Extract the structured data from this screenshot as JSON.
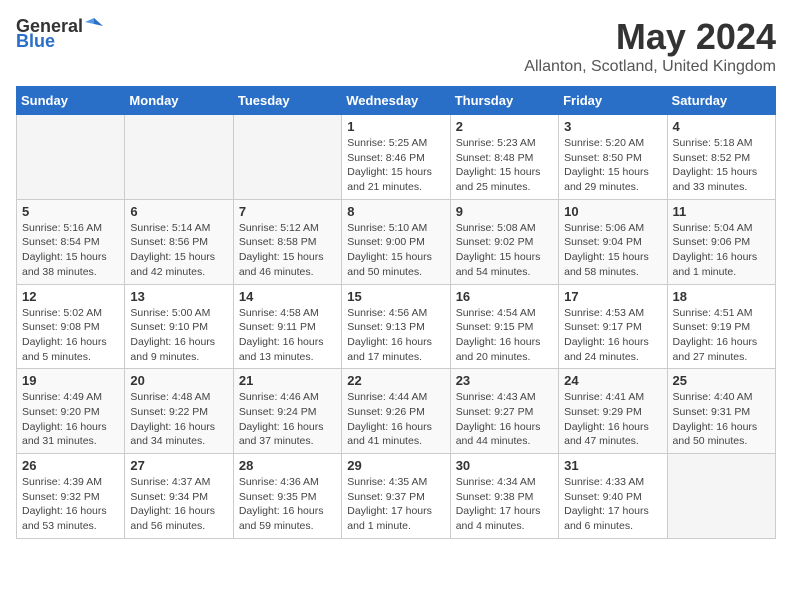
{
  "logo": {
    "general": "General",
    "blue": "Blue"
  },
  "title": "May 2024",
  "subtitle": "Allanton, Scotland, United Kingdom",
  "weekdays": [
    "Sunday",
    "Monday",
    "Tuesday",
    "Wednesday",
    "Thursday",
    "Friday",
    "Saturday"
  ],
  "weeks": [
    [
      {
        "day": "",
        "info": ""
      },
      {
        "day": "",
        "info": ""
      },
      {
        "day": "",
        "info": ""
      },
      {
        "day": "1",
        "info": "Sunrise: 5:25 AM\nSunset: 8:46 PM\nDaylight: 15 hours and 21 minutes."
      },
      {
        "day": "2",
        "info": "Sunrise: 5:23 AM\nSunset: 8:48 PM\nDaylight: 15 hours and 25 minutes."
      },
      {
        "day": "3",
        "info": "Sunrise: 5:20 AM\nSunset: 8:50 PM\nDaylight: 15 hours and 29 minutes."
      },
      {
        "day": "4",
        "info": "Sunrise: 5:18 AM\nSunset: 8:52 PM\nDaylight: 15 hours and 33 minutes."
      }
    ],
    [
      {
        "day": "5",
        "info": "Sunrise: 5:16 AM\nSunset: 8:54 PM\nDaylight: 15 hours and 38 minutes."
      },
      {
        "day": "6",
        "info": "Sunrise: 5:14 AM\nSunset: 8:56 PM\nDaylight: 15 hours and 42 minutes."
      },
      {
        "day": "7",
        "info": "Sunrise: 5:12 AM\nSunset: 8:58 PM\nDaylight: 15 hours and 46 minutes."
      },
      {
        "day": "8",
        "info": "Sunrise: 5:10 AM\nSunset: 9:00 PM\nDaylight: 15 hours and 50 minutes."
      },
      {
        "day": "9",
        "info": "Sunrise: 5:08 AM\nSunset: 9:02 PM\nDaylight: 15 hours and 54 minutes."
      },
      {
        "day": "10",
        "info": "Sunrise: 5:06 AM\nSunset: 9:04 PM\nDaylight: 15 hours and 58 minutes."
      },
      {
        "day": "11",
        "info": "Sunrise: 5:04 AM\nSunset: 9:06 PM\nDaylight: 16 hours and 1 minute."
      }
    ],
    [
      {
        "day": "12",
        "info": "Sunrise: 5:02 AM\nSunset: 9:08 PM\nDaylight: 16 hours and 5 minutes."
      },
      {
        "day": "13",
        "info": "Sunrise: 5:00 AM\nSunset: 9:10 PM\nDaylight: 16 hours and 9 minutes."
      },
      {
        "day": "14",
        "info": "Sunrise: 4:58 AM\nSunset: 9:11 PM\nDaylight: 16 hours and 13 minutes."
      },
      {
        "day": "15",
        "info": "Sunrise: 4:56 AM\nSunset: 9:13 PM\nDaylight: 16 hours and 17 minutes."
      },
      {
        "day": "16",
        "info": "Sunrise: 4:54 AM\nSunset: 9:15 PM\nDaylight: 16 hours and 20 minutes."
      },
      {
        "day": "17",
        "info": "Sunrise: 4:53 AM\nSunset: 9:17 PM\nDaylight: 16 hours and 24 minutes."
      },
      {
        "day": "18",
        "info": "Sunrise: 4:51 AM\nSunset: 9:19 PM\nDaylight: 16 hours and 27 minutes."
      }
    ],
    [
      {
        "day": "19",
        "info": "Sunrise: 4:49 AM\nSunset: 9:20 PM\nDaylight: 16 hours and 31 minutes."
      },
      {
        "day": "20",
        "info": "Sunrise: 4:48 AM\nSunset: 9:22 PM\nDaylight: 16 hours and 34 minutes."
      },
      {
        "day": "21",
        "info": "Sunrise: 4:46 AM\nSunset: 9:24 PM\nDaylight: 16 hours and 37 minutes."
      },
      {
        "day": "22",
        "info": "Sunrise: 4:44 AM\nSunset: 9:26 PM\nDaylight: 16 hours and 41 minutes."
      },
      {
        "day": "23",
        "info": "Sunrise: 4:43 AM\nSunset: 9:27 PM\nDaylight: 16 hours and 44 minutes."
      },
      {
        "day": "24",
        "info": "Sunrise: 4:41 AM\nSunset: 9:29 PM\nDaylight: 16 hours and 47 minutes."
      },
      {
        "day": "25",
        "info": "Sunrise: 4:40 AM\nSunset: 9:31 PM\nDaylight: 16 hours and 50 minutes."
      }
    ],
    [
      {
        "day": "26",
        "info": "Sunrise: 4:39 AM\nSunset: 9:32 PM\nDaylight: 16 hours and 53 minutes."
      },
      {
        "day": "27",
        "info": "Sunrise: 4:37 AM\nSunset: 9:34 PM\nDaylight: 16 hours and 56 minutes."
      },
      {
        "day": "28",
        "info": "Sunrise: 4:36 AM\nSunset: 9:35 PM\nDaylight: 16 hours and 59 minutes."
      },
      {
        "day": "29",
        "info": "Sunrise: 4:35 AM\nSunset: 9:37 PM\nDaylight: 17 hours and 1 minute."
      },
      {
        "day": "30",
        "info": "Sunrise: 4:34 AM\nSunset: 9:38 PM\nDaylight: 17 hours and 4 minutes."
      },
      {
        "day": "31",
        "info": "Sunrise: 4:33 AM\nSunset: 9:40 PM\nDaylight: 17 hours and 6 minutes."
      },
      {
        "day": "",
        "info": ""
      }
    ]
  ]
}
